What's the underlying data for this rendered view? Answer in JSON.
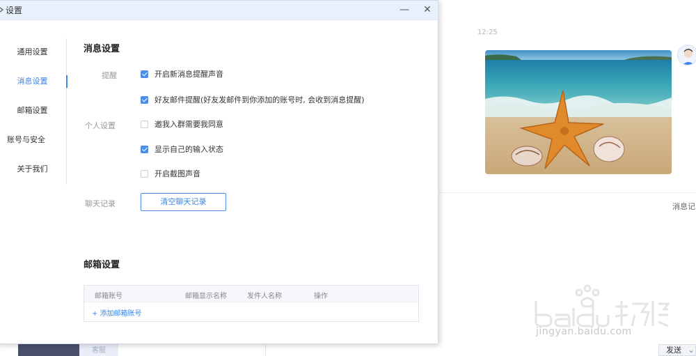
{
  "dialog": {
    "title": "设置",
    "minimize_symbol": "—",
    "close_symbol": "✕"
  },
  "nav": {
    "items": [
      {
        "label": "通用设置",
        "active": false
      },
      {
        "label": "消息设置",
        "active": true
      },
      {
        "label": "邮箱设置",
        "active": false
      },
      {
        "label": "账号与安全",
        "active": false
      },
      {
        "label": "关于我们",
        "active": false
      }
    ]
  },
  "message_settings": {
    "title": "消息设置",
    "reminder_label": "提醒",
    "personal_label": "个人设置",
    "chat_history_label": "聊天记录",
    "options": [
      {
        "label": "开启新消息提醒声音",
        "checked": true
      },
      {
        "label": "好友邮件提醒(好友发邮件到你添加的账号时, 会收到消息提醒)",
        "checked": true
      },
      {
        "label": "邀我入群需要我同意",
        "checked": false
      },
      {
        "label": "显示自己的输入状态",
        "checked": true
      },
      {
        "label": "开启截图声音",
        "checked": false
      }
    ],
    "clear_button": "清空聊天记录"
  },
  "mail_settings": {
    "title": "邮箱设置",
    "columns": [
      "邮箱账号",
      "邮箱显示名称",
      "发件人名称",
      "操作"
    ],
    "add_link": "+ 添加邮箱账号"
  },
  "background": {
    "bottom_tab": "客服",
    "chat_time": "12:25",
    "message_history_link": "消息记",
    "send_button": "发送",
    "send_dropdown_symbol": "⌄",
    "chat_image": "beach-starfish-image",
    "watermark_text": "jingyan.baidu.com"
  },
  "colors": {
    "accent": "#3b86e6",
    "header_bg": "#e8f0fb"
  }
}
